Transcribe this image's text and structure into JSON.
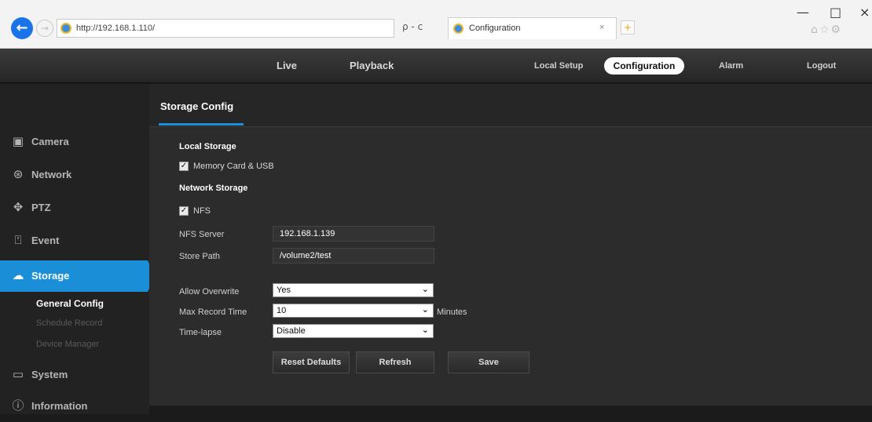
{
  "browser": {
    "back_icon": "arrow-left-icon",
    "forward_icon": "arrow-right-icon",
    "address": "http://192.168.1.110/",
    "search_refresh": "ρ - c",
    "tab_title": "Configuration",
    "tab_close": "×",
    "new_tab": "+",
    "window_min": "—",
    "window_max": "□",
    "window_close": "×",
    "fav_icons": "⌂☆⚙"
  },
  "topnav": {
    "live": "Live",
    "playback": "Playback",
    "local_setup": "Local Setup",
    "configuration": "Configuration",
    "alarm": "Alarm",
    "logout": "Logout"
  },
  "sidebar": {
    "items": [
      {
        "label": "Camera",
        "icon": "camera-icon"
      },
      {
        "label": "Network",
        "icon": "network-icon"
      },
      {
        "label": "PTZ",
        "icon": "ptz-icon"
      },
      {
        "label": "Event",
        "icon": "event-icon"
      },
      {
        "label": "Storage",
        "icon": "storage-icon"
      },
      {
        "label": "System",
        "icon": "system-icon"
      },
      {
        "label": "Information",
        "icon": "information-icon"
      }
    ],
    "storage_sub": [
      "General Config",
      "Schedule Record",
      "Device Manager"
    ]
  },
  "main": {
    "title": "Storage Config",
    "local_storage": "Local Storage",
    "memory_card_label": "Memory Card & USB",
    "memory_card_checked": true,
    "network_storage": "Network Storage",
    "nfs_label": "NFS",
    "nfs_checked": true,
    "nfs_server_label": "NFS Server",
    "nfs_server_value": "192.168.1.139",
    "store_path_label": "Store Path",
    "store_path_value": "/volume2/test",
    "allow_overwrite_label": "Allow Overwrite",
    "allow_overwrite_value": "Yes",
    "max_record_label": "Max Record Time",
    "max_record_value": "10",
    "max_record_unit": "Minutes",
    "timelapse_label": "Time-lapse",
    "timelapse_value": "Disable",
    "reset_button": "Reset Defaults",
    "refresh_button": "Refresh",
    "save_button": "Save"
  },
  "colors": {
    "accent": "#1a8fd8",
    "background": "#2c2c2c",
    "sidebar": "#222222"
  }
}
